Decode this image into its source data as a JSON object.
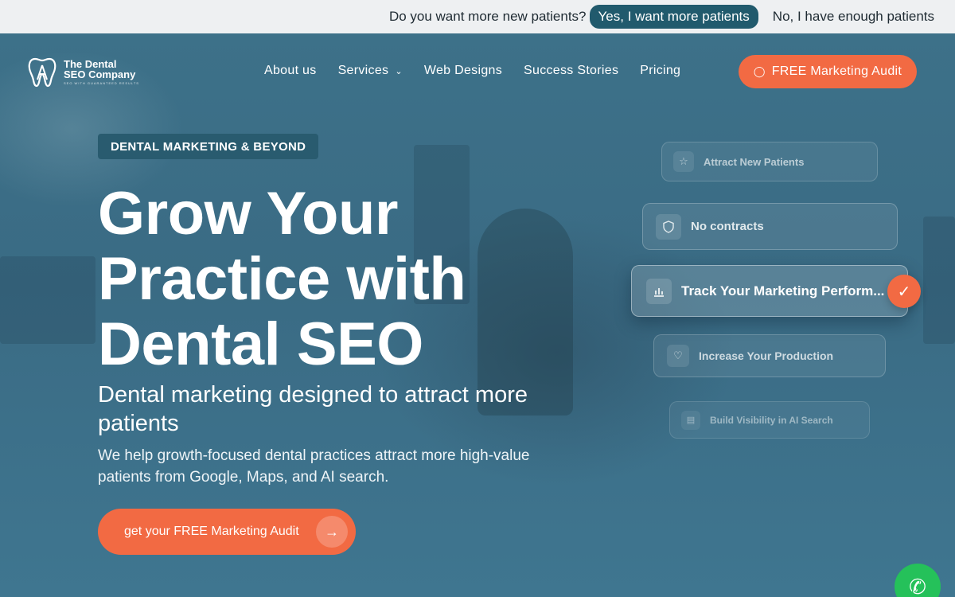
{
  "topbar": {
    "question": "Do you want more new patients?",
    "yes_label": "Yes, I want more patients",
    "no_label": "No, I have enough patients"
  },
  "logo": {
    "line1": "The Dental",
    "line2": "SEO Company",
    "tagline": "SEO WITH GUARANTEED RESULTS"
  },
  "nav": {
    "items": [
      {
        "label": "About us"
      },
      {
        "label": "Services"
      },
      {
        "label": "Web Designs"
      },
      {
        "label": "Success Stories"
      },
      {
        "label": "Pricing"
      }
    ],
    "audit_label": "FREE Marketing Audit"
  },
  "hero": {
    "badge": "DENTAL MARKETING & BEYOND",
    "headline": [
      "Grow Your",
      "Practice with",
      "Dental SEO"
    ],
    "subhead": "Dental marketing designed to attract more patients",
    "description": "We help growth-focused dental practices attract more high-value patients from Google, Maps, and AI search.",
    "cta_label": "get your FREE Marketing Audit"
  },
  "features": [
    {
      "label": "Attract New Patients",
      "icon": "star-icon"
    },
    {
      "label": "No contracts",
      "icon": "shield-icon"
    },
    {
      "label": "Track Your Marketing Perform...",
      "icon": "bar-chart-icon"
    },
    {
      "label": "Increase Your Production",
      "icon": "heart-icon"
    },
    {
      "label": "Build Visibility in AI Search",
      "icon": "document-icon"
    }
  ],
  "colors": {
    "accent": "#f26a43",
    "hero_bg": "#3b6e87",
    "topbar_button": "#215a6d",
    "phone": "#25c15a"
  }
}
